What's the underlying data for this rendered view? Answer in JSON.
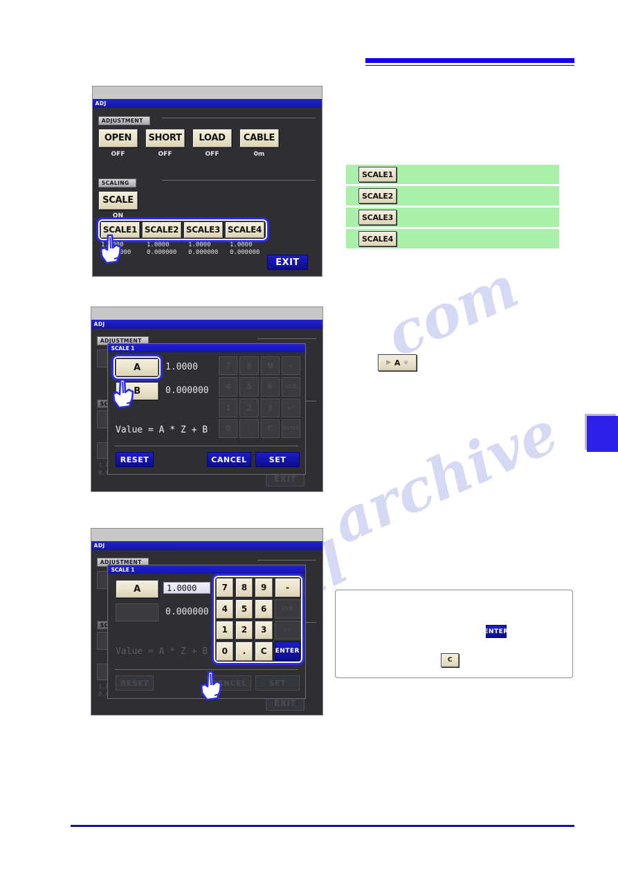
{
  "device_screen": {
    "title": "ADJ",
    "sections": {
      "adjustment": "ADJUSTMENT",
      "scaling": "SCALING",
      "scale_dialog": "SCALE 1"
    }
  },
  "panel1": {
    "title": "ADJ",
    "section_adjustment": "ADJUSTMENT",
    "adjust_buttons": [
      {
        "label": "OPEN",
        "state": "OFF"
      },
      {
        "label": "SHORT",
        "state": "OFF"
      },
      {
        "label": "LOAD",
        "state": "OFF"
      },
      {
        "label": "CABLE",
        "state": "0m"
      }
    ],
    "section_scaling": "SCALING",
    "scale_toggle": {
      "label": "SCALE",
      "state": "ON"
    },
    "scale_buttons": [
      {
        "label": "SCALE1",
        "a": "1.0000",
        "b": "0.000000"
      },
      {
        "label": "SCALE2",
        "a": "1.0000",
        "b": "0.000000"
      },
      {
        "label": "SCALE3",
        "a": "1.0000",
        "b": "0.000000"
      },
      {
        "label": "SCALE4",
        "a": "1.0000",
        "b": "0.000000"
      }
    ],
    "exit_label": "EXIT"
  },
  "green_list": {
    "rows": [
      {
        "button": "SCALE1",
        "text": ""
      },
      {
        "button": "SCALE2",
        "text": ""
      },
      {
        "button": "SCALE3",
        "text": ""
      },
      {
        "button": "SCALE4",
        "text": ""
      }
    ],
    "background_color": "#aaf0aa"
  },
  "panel2": {
    "title": "ADJ",
    "section_adjustment": "ADJUSTMENT",
    "dialog_title": "SCALE 1",
    "coef_a_label": "A",
    "coef_a_value": "1.0000",
    "coef_b_label": "B",
    "coef_b_value": "0.000000",
    "formula": "Value = A * Z + B",
    "keypad_dim": [
      "7",
      "8",
      "9",
      "-",
      "4",
      "5",
      "6",
      "CLR",
      "1",
      "2",
      "3",
      "+/-",
      "0",
      ".",
      "C",
      "ENTER"
    ],
    "reset_label": "RESET",
    "cancel_label": "CANCEL",
    "set_label": "SET",
    "exit_label": "EXIT"
  },
  "sample_a_button": {
    "label": "A",
    "left_chevron": "▶",
    "right_diamond": "◆"
  },
  "panel3": {
    "title": "ADJ",
    "section_adjustment": "ADJUSTMENT",
    "dialog_title": "SCALE 1",
    "coef_a_label": "A",
    "coef_a_value": "1.0000",
    "coef_b_value": "0.000000",
    "keypad": [
      [
        "7",
        "8",
        "9",
        "-"
      ],
      [
        "4",
        "5",
        "6",
        "CLR"
      ],
      [
        "1",
        "2",
        "3",
        "+/-"
      ],
      [
        "0",
        ".",
        "C",
        "ENTER"
      ]
    ],
    "keypad_enabled": [
      "7",
      "8",
      "9",
      "-",
      "4",
      "5",
      "6",
      "1",
      "2",
      "3",
      "0",
      ".",
      "C",
      "ENTER"
    ],
    "reset_label": "RESET",
    "cancel_label": "CANCEL",
    "set_label": "SET",
    "exit_label": "EXIT"
  },
  "note_box": {
    "enter_label": "ENTER",
    "clear_label": "C",
    "body_text": ""
  },
  "colors": {
    "accent_blue": "#1100ee",
    "panel_bg": "#2e2e33",
    "button_beige": "#ece5cd",
    "highlight_ring": "#2a2af0",
    "green_row": "#aaf0aa"
  },
  "watermark": {
    "line1": "com",
    "line2": "manual",
    "line3": "archive"
  }
}
